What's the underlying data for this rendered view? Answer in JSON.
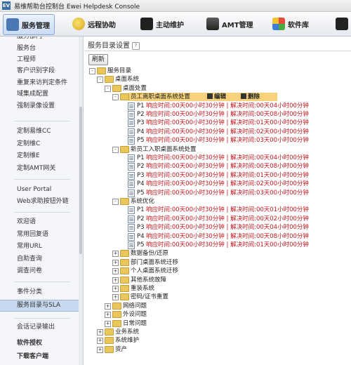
{
  "window": {
    "title": "易维帮助台控制台 Ewei Helpdesk Console",
    "app_icon_text": "EV"
  },
  "toolbar": {
    "items": [
      {
        "label": "服务管理",
        "icon": "service-icon"
      },
      {
        "label": "远程协助",
        "icon": "remote-assist-icon"
      },
      {
        "label": "主动维护",
        "icon": "maintenance-icon"
      },
      {
        "label": "AMT管理",
        "icon": "amt-icon"
      },
      {
        "label": "软件库",
        "icon": "software-library-icon"
      },
      {
        "label": "",
        "icon": "more-icon"
      }
    ]
  },
  "sidebar": {
    "items": [
      "服务部门",
      "服务台",
      "工程师",
      "客户识别字段",
      "重复来访判定条件",
      "域集成配置",
      "强制录像设置",
      "定制易维CC",
      "定制维C",
      "定制维E",
      "定制AMT网关",
      "User Portal",
      "Web求助按钮外链",
      "欢迎语",
      "常用回复语",
      "常用URL",
      "自助查询",
      "调查问卷",
      "事件分类",
      "服务目录与SLA",
      "会话记录输出",
      "软件授权",
      "下载客户端"
    ]
  },
  "main": {
    "title": "服务目录设置",
    "help": "?",
    "refresh_label": "刷新",
    "actions": {
      "edit": "编辑",
      "delete": "删除"
    },
    "tree": [
      {
        "expander": "-",
        "icon": "folder",
        "label": "服务目录"
      },
      {
        "expander": "-",
        "icon": "folder",
        "label": "桌面系统"
      },
      {
        "expander": "-",
        "icon": "folder",
        "label": "桌面处置"
      },
      {
        "expander": "-",
        "icon": "folder",
        "label": "员工离职桌面系统处置",
        "selected": true
      },
      {
        "icon": "doc",
        "prio": "P1",
        "sla": "响应时间:00天00小时30分钟 | 解决时间:00天04小时00分钟"
      },
      {
        "icon": "doc",
        "prio": "P2",
        "sla": "响应时间:00天00小时30分钟 | 解决时间:00天08小时00分钟"
      },
      {
        "icon": "doc",
        "prio": "P3",
        "sla": "响应时间:00天00小时30分钟 | 解决时间:01天00小时00分钟"
      },
      {
        "icon": "doc",
        "prio": "P4",
        "sla": "响应时间:00天00小时30分钟 | 解决时间:02天00小时00分钟"
      },
      {
        "icon": "doc",
        "prio": "P5",
        "sla": "响应时间:00天00小时30分钟 | 解决时间:03天00小时00分钟"
      },
      {
        "expander": "-",
        "icon": "folder",
        "label": "新员工入职桌面系统处置"
      },
      {
        "icon": "doc",
        "prio": "P1",
        "sla": "响应时间:00天00小时30分钟 | 解决时间:00天04小时00分钟"
      },
      {
        "icon": "doc",
        "prio": "P2",
        "sla": "响应时间:00天00小时30分钟 | 解决时间:00天08小时00分钟"
      },
      {
        "icon": "doc",
        "prio": "P3",
        "sla": "响应时间:00天00小时30分钟 | 解决时间:01天00小时00分钟"
      },
      {
        "icon": "doc",
        "prio": "P4",
        "sla": "响应时间:00天00小时30分钟 | 解决时间:02天00小时00分钟"
      },
      {
        "icon": "doc",
        "prio": "P5",
        "sla": "响应时间:00天00小时30分钟 | 解决时间:03天00小时00分钟"
      },
      {
        "expander": "-",
        "icon": "folder",
        "label": "系统优化"
      },
      {
        "icon": "doc",
        "prio": "P1",
        "sla": "响应时间:00天00小时30分钟 | 解决时间:00天01小时00分钟"
      },
      {
        "icon": "doc",
        "prio": "P2",
        "sla": "响应时间:00天00小时30分钟 | 解决时间:00天02小时00分钟"
      },
      {
        "icon": "doc",
        "prio": "P3",
        "sla": "响应时间:00天00小时30分钟 | 解决时间:00天04小时00分钟"
      },
      {
        "icon": "doc",
        "prio": "P4",
        "sla": "响应时间:00天00小时30分钟 | 解决时间:00天08小时00分钟"
      },
      {
        "icon": "doc",
        "prio": "P5",
        "sla": "响应时间:00天00小时30分钟 | 解决时间:01天00小时00分钟"
      },
      {
        "expander": "+",
        "icon": "folder",
        "label": "数据备份/还原"
      },
      {
        "expander": "+",
        "icon": "folder",
        "label": "部门桌面系统迁移"
      },
      {
        "expander": "+",
        "icon": "folder",
        "label": "个人桌面系统迁移"
      },
      {
        "expander": "+",
        "icon": "folder",
        "label": "其他系统故障"
      },
      {
        "expander": "+",
        "icon": "folder",
        "label": "重装系统"
      },
      {
        "expander": "+",
        "icon": "folder",
        "label": "密码/证书重置"
      },
      {
        "expander": "+",
        "icon": "folder",
        "label": "网络问题"
      },
      {
        "expander": "+",
        "icon": "folder",
        "label": "外设问题"
      },
      {
        "expander": "+",
        "icon": "folder",
        "label": "日常问题"
      },
      {
        "expander": "+",
        "icon": "folder",
        "label": "业务系统"
      },
      {
        "expander": "+",
        "icon": "folder",
        "label": "系统维护"
      },
      {
        "expander": "+",
        "icon": "folder",
        "label": "资产"
      }
    ]
  },
  "colors": {
    "accent": "#c0161c",
    "selected_row": "#f5d27b",
    "sidebar_selected": "#c8d8ee"
  }
}
